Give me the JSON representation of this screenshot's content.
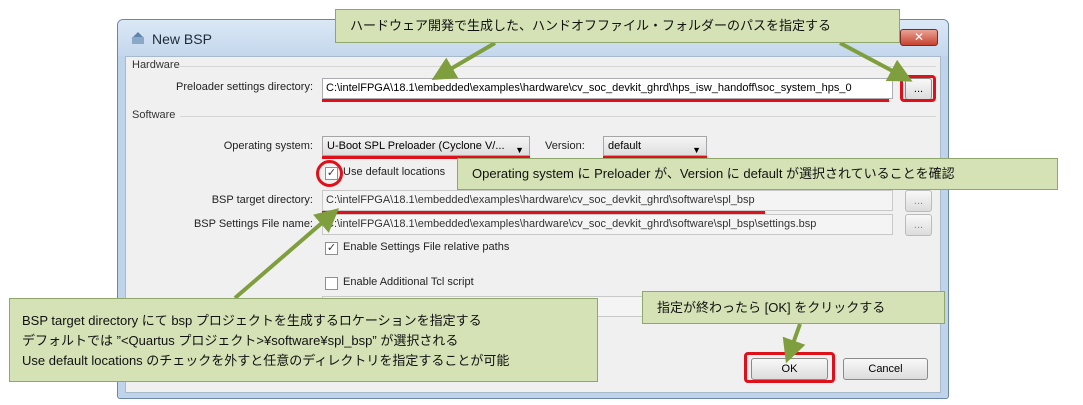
{
  "window": {
    "title": "New BSP",
    "close_glyph": "✕"
  },
  "hardware": {
    "group_label": "Hardware",
    "preloader_label": "Preloader settings directory:",
    "preloader_value": "C:\\intelFPGA\\18.1\\embedded\\examples\\hardware\\cv_soc_devkit_ghrd\\hps_isw_handoff\\soc_system_hps_0",
    "browse_label": "..."
  },
  "software": {
    "group_label": "Software",
    "os_label": "Operating system:",
    "os_value": "U-Boot SPL Preloader (Cyclone V/...",
    "version_label": "Version:",
    "version_value": "default",
    "use_default_label": "Use default locations",
    "bsp_target_label": "BSP target directory:",
    "bsp_target_value": "C:\\intelFPGA\\18.1\\embedded\\examples\\hardware\\cv_soc_devkit_ghrd\\software\\spl_bsp",
    "bsp_settings_label": "BSP Settings File name:",
    "bsp_settings_value": "C:\\intelFPGA\\18.1\\embedded\\examples\\hardware\\cv_soc_devkit_ghrd\\software\\spl_bsp\\settings.bsp",
    "browse_label": "...",
    "relative_paths_label": "Enable Settings File relative paths",
    "additional_tcl_label": "Enable Additional Tcl script"
  },
  "buttons": {
    "ok": "OK",
    "cancel": "Cancel"
  },
  "annotations": {
    "top": "ハードウェア開発で生成した、ハンドオフファイル・フォルダーのパスを指定する",
    "middle": "Operating system に Preloader が、Version に default が選択されていることを確認",
    "left_line1": "BSP target directory にて bsp プロジェクトを生成するロケーションを指定する",
    "left_line2": "デフォルトでは ”<Quartus プロジェクト>¥software¥spl_bsp” が選択される",
    "left_line3": "Use default locations のチェックを外すと任意のディレクトリを指定することが可能",
    "right": "指定が終わったら [OK] をクリックする"
  },
  "colors": {
    "annotation_red": "#e0101a",
    "callout_bg": "#d5e2b6",
    "arrow_green": "#7f9f3e"
  }
}
